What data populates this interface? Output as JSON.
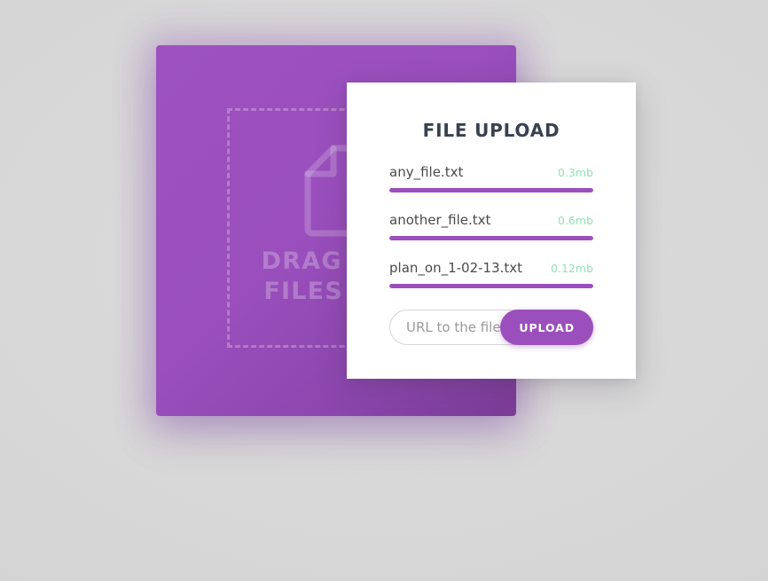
{
  "theme": {
    "page_background": "#d8d8d8",
    "card_purple_light": "#9d52bf",
    "card_purple_dark": "#7a3c97",
    "accent_purple": "#9b4fbd",
    "title_color": "#38424f",
    "filesize_green": "#94e2b4",
    "filename_color": "#4a4a4a"
  },
  "drop_zone": {
    "icon": "document-icon",
    "text": "DRAG YOUR\nFILES HERE"
  },
  "panel": {
    "title": "FILE UPLOAD",
    "files": [
      {
        "name": "any_file.txt",
        "size": "0.3mb",
        "progress": 100
      },
      {
        "name": "another_file.txt",
        "size": "0.6mb",
        "progress": 100
      },
      {
        "name": "plan_on_1-02-13.txt",
        "size": "0.12mb",
        "progress": 100
      }
    ],
    "url_field": {
      "placeholder": "URL to the file",
      "value": ""
    },
    "upload_button_label": "UPLOAD"
  }
}
